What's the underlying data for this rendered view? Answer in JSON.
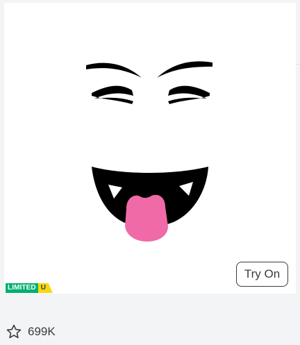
{
  "item": {
    "badge_limited": "LIMITED",
    "badge_unique": "U",
    "try_on_label": "Try On",
    "favorite_count": "699K"
  },
  "icons": {
    "favorite": "star-outline-icon"
  },
  "colors": {
    "limited_green": "#00b06f",
    "unique_yellow": "#f6d80f",
    "tongue_pink": "#f06aa8",
    "text_dark": "#393b3d",
    "page_bg": "#f2f4f5"
  }
}
